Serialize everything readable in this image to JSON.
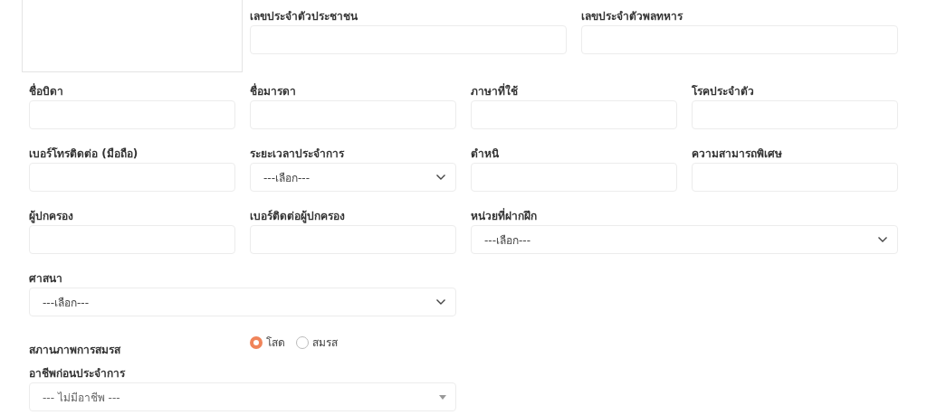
{
  "rows": [
    {
      "fields": [
        {
          "kind": "text",
          "label": "เลขประจำตัวประชาชน"
        },
        {
          "kind": "text",
          "label": "เลขประจำตัวพลทหาร"
        }
      ]
    },
    {
      "fields": [
        {
          "kind": "text",
          "label": "ชื่อบิดา"
        },
        {
          "kind": "text",
          "label": "ชื่อมารดา"
        },
        {
          "kind": "text",
          "label": "ภาษาที่ใช้"
        },
        {
          "kind": "text",
          "label": "โรคประจำตัว"
        }
      ]
    },
    {
      "fields": [
        {
          "kind": "text",
          "label": "เบอร์โทรติดต่อ (มือถือ)"
        },
        {
          "kind": "select",
          "label": "ระยะเวลาประจำการ",
          "value": "---เลือก---"
        },
        {
          "kind": "text",
          "label": "ตำหนิ"
        },
        {
          "kind": "text",
          "label": "ความสามารถพิเศษ"
        }
      ]
    },
    {
      "fields": [
        {
          "kind": "text",
          "label": "ผู้ปกครอง"
        },
        {
          "kind": "text",
          "label": "เบอร์ติดต่อผู้ปกครอง"
        },
        {
          "kind": "select",
          "label": "หน่วยที่ฝากฝึก",
          "value": "---เลือก---"
        }
      ]
    },
    {
      "fields": [
        {
          "kind": "select",
          "label": "ศาสนา",
          "value": "---เลือก---"
        }
      ]
    },
    {
      "fields": [
        {
          "kind": "radio",
          "label": "สภานภาพการสมรส",
          "options": [
            {
              "label": "โสด",
              "selected": true
            },
            {
              "label": "สมรส",
              "selected": false
            }
          ]
        }
      ]
    },
    {
      "fields": [
        {
          "kind": "combo",
          "label": "อาชีพก่อนประจำการ",
          "value": "--- ไม่มีอาชีพ ---"
        }
      ]
    }
  ]
}
